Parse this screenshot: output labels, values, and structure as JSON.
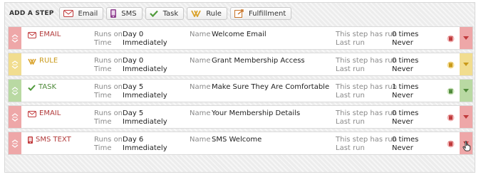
{
  "toolbar": {
    "add_step_label": "ADD A STEP",
    "buttons": [
      {
        "label": "Email",
        "icon": "envelope-icon"
      },
      {
        "label": "SMS",
        "icon": "phone-icon"
      },
      {
        "label": "Task",
        "icon": "checkmark-icon"
      },
      {
        "label": "Rule",
        "icon": "rule-icon"
      },
      {
        "label": "Fulfillment",
        "icon": "fulfillment-icon"
      }
    ]
  },
  "labels": {
    "runs_on": "Runs on",
    "time": "Time",
    "name": "Name",
    "step_has_run": "This step has run",
    "last_run": "Last run"
  },
  "colors": {
    "red": "#eea7a8",
    "yellow": "#f1dd8f",
    "green": "#b9d9a3"
  },
  "steps": [
    {
      "type": "EMAIL",
      "icon": "envelope-icon",
      "color": "red",
      "runs_on": "Day 0",
      "time": "Immediately",
      "name": "Welcome Email",
      "run_count": "0 times",
      "last_run": "Never"
    },
    {
      "type": "RULE",
      "icon": "rule-icon",
      "color": "yellow",
      "runs_on": "Day 0",
      "time": "Immediately",
      "name": "Grant Membership Access",
      "run_count": "0 times",
      "last_run": "Never"
    },
    {
      "type": "TASK",
      "icon": "checkmark-icon",
      "color": "green",
      "runs_on": "Day 5",
      "time": "Immediately",
      "name": "Make Sure They Are Comfortable",
      "run_count": "1 times",
      "last_run": "Never"
    },
    {
      "type": "EMAIL",
      "icon": "envelope-icon",
      "color": "red",
      "runs_on": "Day 5",
      "time": "Immediately",
      "name": "Your Membership Details",
      "run_count": "0 times",
      "last_run": "Never"
    },
    {
      "type": "SMS TEXT",
      "icon": "phone-icon",
      "color": "red",
      "runs_on": "Day 6",
      "time": "Immediately",
      "name": "SMS Welcome",
      "run_count": "0 times",
      "last_run": "Never"
    }
  ]
}
